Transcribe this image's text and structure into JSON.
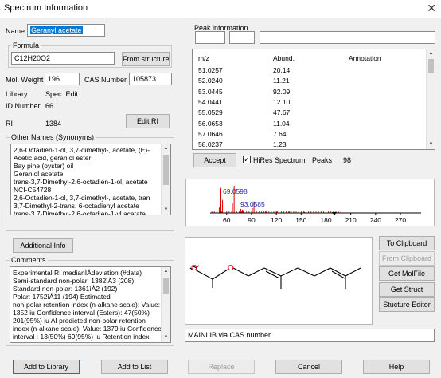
{
  "window": {
    "title": "Spectrum Information",
    "close_glyph": "✕"
  },
  "name": {
    "label": "Name",
    "value": "Geranyl acetate"
  },
  "formula": {
    "group_title": "Formula",
    "value": "C12H20O2",
    "button": "From structure"
  },
  "mol_weight": {
    "label": "Mol. Weight",
    "value": "196"
  },
  "cas": {
    "label": "CAS Number",
    "value": "105873"
  },
  "library": {
    "label": "Library",
    "value": "Spec. Edit"
  },
  "id_number": {
    "label": "ID Number",
    "value": "66"
  },
  "ri": {
    "label": "RI",
    "value": "1384",
    "button": "Edit RI"
  },
  "other_names": {
    "group_title": "Other Names (Synonyms)",
    "items": [
      "2,6-Octadien-1-ol, 3,7-dimethyl-, acetate, (E)-",
      "Acetic acid, geraniol ester",
      "Bay pine (oyster) oil",
      "Geraniol acetate",
      "trans-3,7-Dimethyl-2,6-octadien-1-ol, acetate",
      "NCI-C54728",
      "2,6-Octadien-1-ol, 3,7-dimethyl-, acetate, tran",
      "3,7-Dimethyl-2-trans, 6-octadienyl acetate",
      "trans-3,7-Dimethyl-2,6-octadien-1-yl acetate"
    ]
  },
  "additional_info": {
    "button": "Additional Info"
  },
  "comments": {
    "group_title": "Comments",
    "lines": [
      "Experimental RI medianÌÂdeviation (#data)",
      "Semi-standard non-polar:          1382ìÀ3 (208)",
      "Standard non-polar:                 1361ìÀ2 (192)",
      "Polar:                    1752ìÀ11 (194)  Estimated",
      "non-polar retention index (n-alkane scale):  Value:",
      "1352 iu Confidence interval (Esters):  47(50%)",
      "201(95%) iu   AI predicted non-polar retention",
      "index (n-alkane scale):  Value: 1379 iu Confidence",
      "interval : 13(50%) 69(95%) iu  Retention index.",
      "1. Value: 1360 iu Column Type: Capillary Column"
    ]
  },
  "peak_info": {
    "group_title": "Peak information",
    "columns": [
      "m/z",
      "Abund.",
      "Annotation"
    ],
    "rows": [
      {
        "mz": "51.0257",
        "abund": "20.14"
      },
      {
        "mz": "52.0240",
        "abund": "11.21"
      },
      {
        "mz": "53.0445",
        "abund": "92.09"
      },
      {
        "mz": "54.0441",
        "abund": "12.10"
      },
      {
        "mz": "55.0529",
        "abund": "47.67"
      },
      {
        "mz": "56.0653",
        "abund": "11.04"
      },
      {
        "mz": "57.0646",
        "abund": "7.64"
      },
      {
        "mz": "58.0237",
        "abund": "1.23"
      },
      {
        "mz": "59.0172",
        "abund": "2.27"
      }
    ],
    "accept_button": "Accept",
    "hires": {
      "label": "HiRes Spectrum",
      "checked": true
    },
    "peaks": {
      "label": "Peaks",
      "value": "98"
    }
  },
  "spectrum": {
    "label_1": "69.0598",
    "label_2": "93.0585",
    "label_1_color": "#1f2aa0",
    "label_2_color": "#1f2aa0",
    "peak_color": "#e00000",
    "x_ticks": [
      "60",
      "90",
      "120",
      "150",
      "180",
      "210",
      "240",
      "270"
    ]
  },
  "right_buttons": {
    "to_clipboard": "To Clipboard",
    "from_clipboard": "From Clipboard",
    "get_molfile": "Get MolFile",
    "get_struct": "Get Struct",
    "structure_editor": "Stucture Editor"
  },
  "source_field": {
    "value": "MAINLIB via CAS number"
  },
  "bottom_buttons": {
    "add_to_library": "Add to Library",
    "add_to_list": "Add to List",
    "replace": "Replace",
    "cancel": "Cancel",
    "help": "Help"
  },
  "chart_data": {
    "type": "bar",
    "x": [
      51,
      53,
      55,
      67,
      69,
      77,
      79,
      80,
      91,
      93,
      107,
      121,
      136,
      154,
      196
    ],
    "y": [
      20,
      92,
      48,
      35,
      100,
      15,
      12,
      10,
      18,
      42,
      9,
      8,
      6,
      4,
      2
    ],
    "xlim": [
      40,
      295
    ],
    "x_ticks": [
      60,
      90,
      120,
      150,
      180,
      210,
      240,
      270
    ]
  }
}
